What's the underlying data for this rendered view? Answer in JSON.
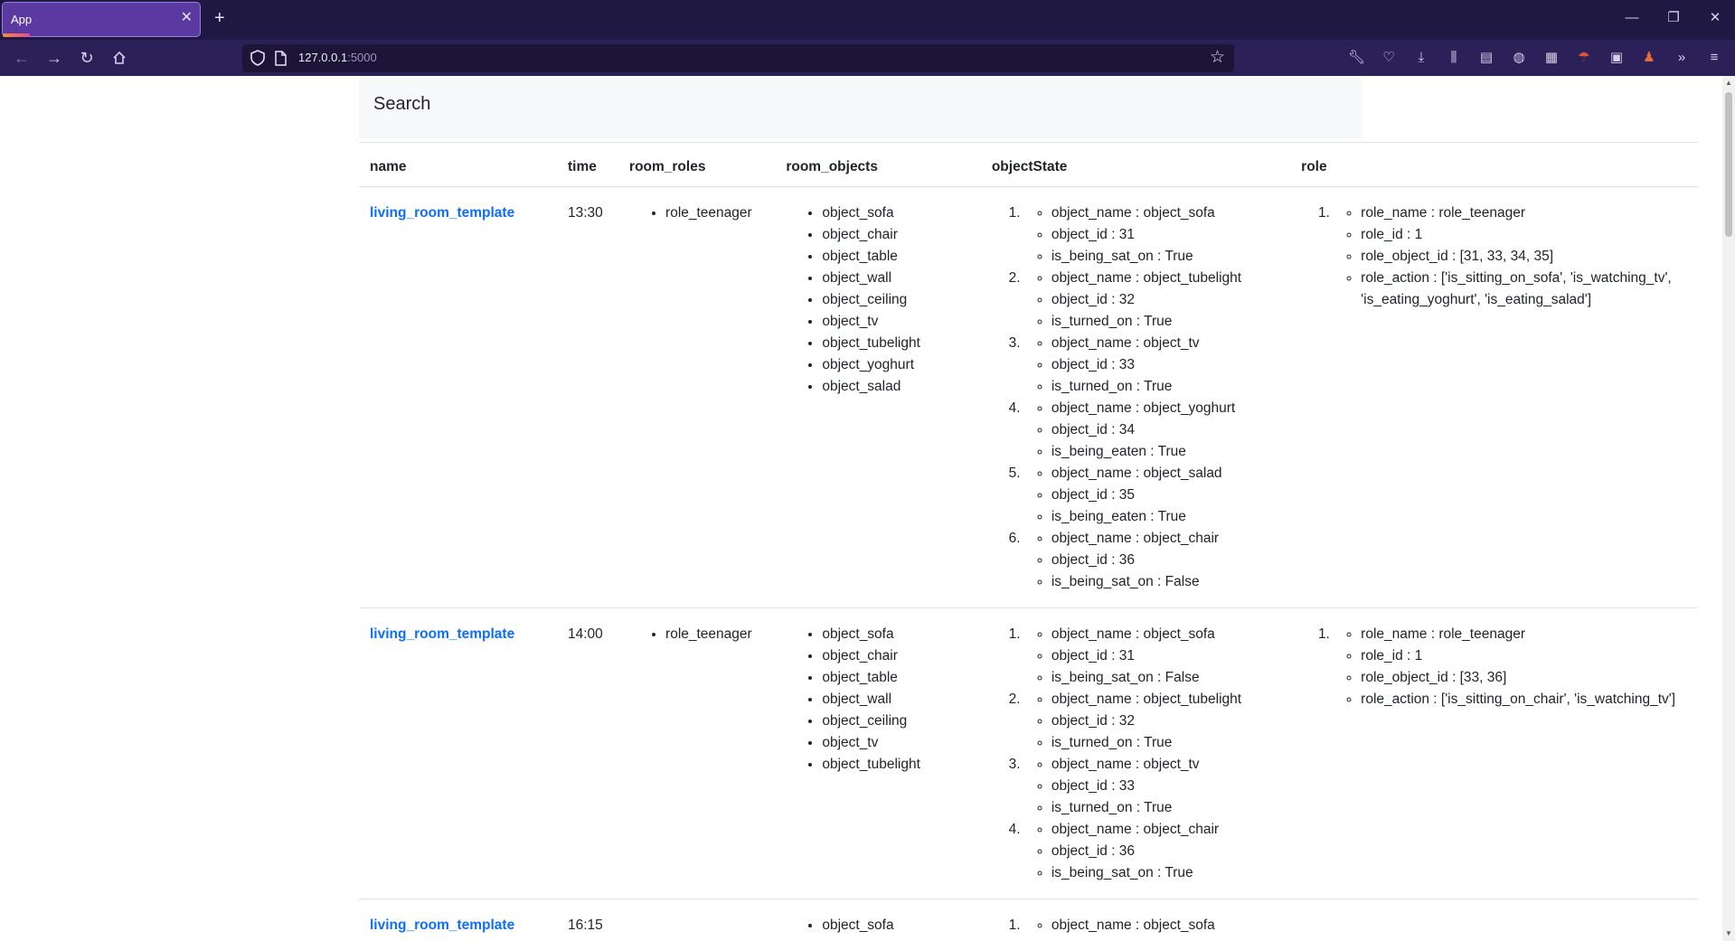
{
  "browser": {
    "tab_title": "App",
    "url_host": "127.0.0.1",
    "url_port": ":5000"
  },
  "search": {
    "label": "Search"
  },
  "table": {
    "headers": [
      "name",
      "time",
      "room_roles",
      "room_objects",
      "objectState",
      "role"
    ],
    "rows": [
      {
        "name": "living_room_template",
        "time": "13:30",
        "room_roles": [
          "role_teenager"
        ],
        "room_objects": [
          "object_sofa",
          "object_chair",
          "object_table",
          "object_wall",
          "object_ceiling",
          "object_tv",
          "object_tubelight",
          "object_yoghurt",
          "object_salad"
        ],
        "object_state": [
          [
            "object_name : object_sofa",
            "object_id : 31",
            "is_being_sat_on : True"
          ],
          [
            "object_name : object_tubelight",
            "object_id : 32",
            "is_turned_on : True"
          ],
          [
            "object_name : object_tv",
            "object_id : 33",
            "is_turned_on : True"
          ],
          [
            "object_name : object_yoghurt",
            "object_id : 34",
            "is_being_eaten : True"
          ],
          [
            "object_name : object_salad",
            "object_id : 35",
            "is_being_eaten : True"
          ],
          [
            "object_name : object_chair",
            "object_id : 36",
            "is_being_sat_on : False"
          ]
        ],
        "role": [
          [
            "role_name : role_teenager",
            "role_id : 1",
            "role_object_id : [31, 33, 34, 35]",
            "role_action : ['is_sitting_on_sofa', 'is_watching_tv', 'is_eating_yoghurt', 'is_eating_salad']"
          ]
        ]
      },
      {
        "name": "living_room_template",
        "time": "14:00",
        "room_roles": [
          "role_teenager"
        ],
        "room_objects": [
          "object_sofa",
          "object_chair",
          "object_table",
          "object_wall",
          "object_ceiling",
          "object_tv",
          "object_tubelight"
        ],
        "object_state": [
          [
            "object_name : object_sofa",
            "object_id : 31",
            "is_being_sat_on : False"
          ],
          [
            "object_name : object_tubelight",
            "object_id : 32",
            "is_turned_on : True"
          ],
          [
            "object_name : object_tv",
            "object_id : 33",
            "is_turned_on : True"
          ],
          [
            "object_name : object_chair",
            "object_id : 36",
            "is_being_sat_on : True"
          ]
        ],
        "role": [
          [
            "role_name : role_teenager",
            "role_id : 1",
            "role_object_id : [33, 36]",
            "role_action : ['is_sitting_on_chair', 'is_watching_tv']"
          ]
        ]
      },
      {
        "name": "living_room_template",
        "time": "16:15",
        "room_roles": [],
        "room_objects": [
          "object_sofa"
        ],
        "object_state": [
          [
            "object_name : object_sofa"
          ]
        ],
        "role": []
      }
    ]
  }
}
